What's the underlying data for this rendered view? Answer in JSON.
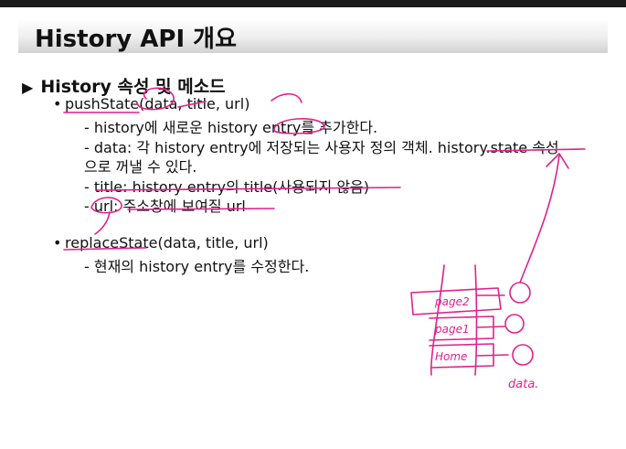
{
  "title": "History API 개요",
  "section": "History 속성 및 메소드",
  "items": [
    {
      "label": "pushState(data, title, url)",
      "details": [
        "- history에 새로운 history entry를 추가한다.",
        "- data: 각 history entry에 저장되는 사용자 정의 객체. history.state 속성",
        "으로 꺼낼 수 있다.",
        "- title: history entry의 title(사용되지 않음)",
        "- url: 주소창에 보여질 url"
      ]
    },
    {
      "label": "replaceState(data, title, url)",
      "details": [
        "- 현재의 history entry를 수정한다."
      ]
    }
  ],
  "annotation": {
    "stack": [
      "page2",
      "page1",
      "Home"
    ],
    "note": "data.",
    "ink_color": "#e0218a"
  }
}
